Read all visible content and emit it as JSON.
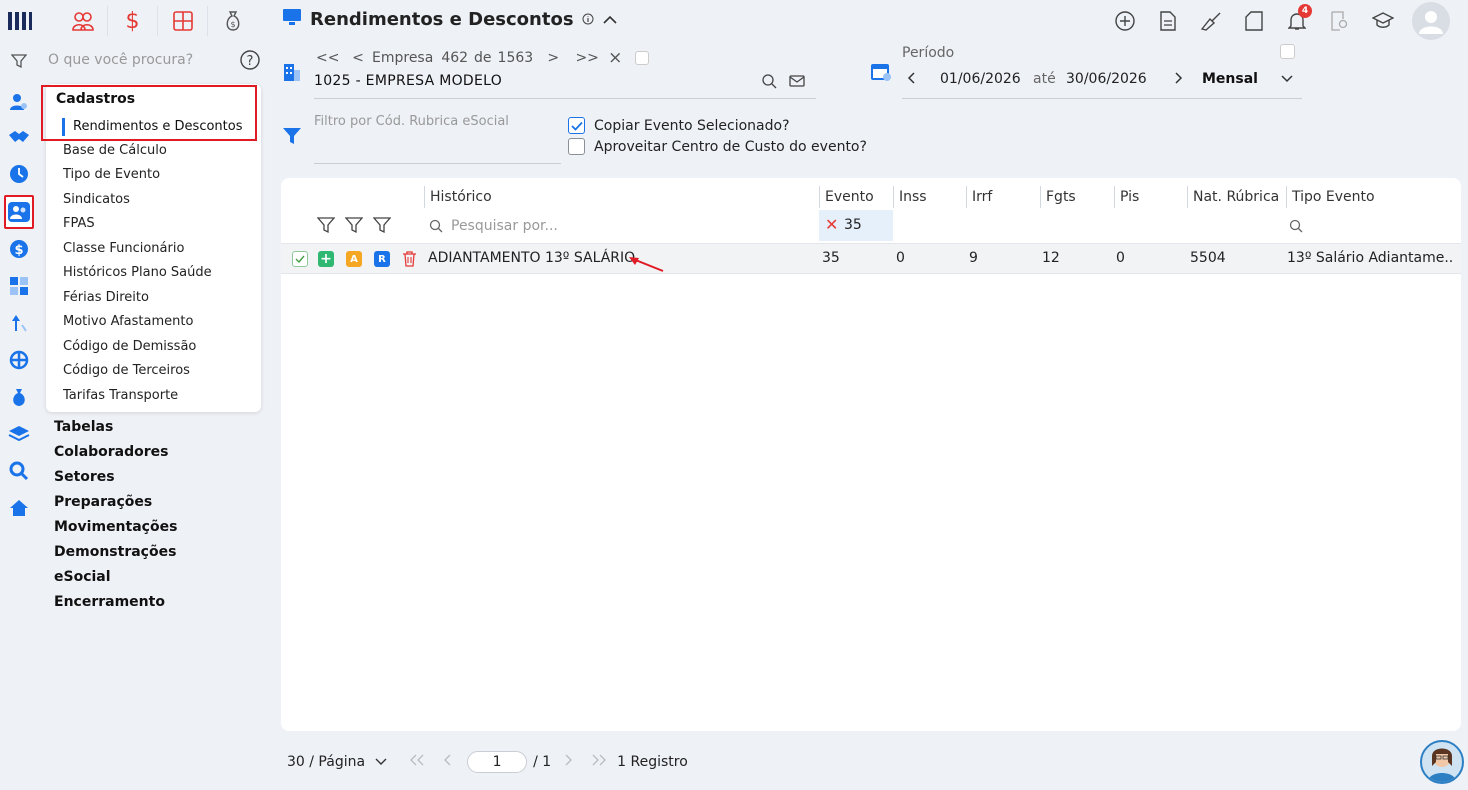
{
  "nav": {
    "search_placeholder": "O que você procura?",
    "menu": {
      "title": "Cadastros",
      "active_item": "Rendimentos e Descontos",
      "items": [
        "Base de Cálculo",
        "Tipo de Evento",
        "Sindicatos",
        "FPAS",
        "Classe Funcionário",
        "Históricos Plano Saúde",
        "Férias Direito",
        "Motivo Afastamento",
        "Código de Demissão",
        "Código de Terceiros",
        "Tarifas Transporte"
      ]
    },
    "sections": [
      "Tabelas",
      "Colaboradores",
      "Setores",
      "Preparações",
      "Movimentações",
      "Demonstrações",
      "eSocial",
      "Encerramento"
    ]
  },
  "header": {
    "title": "Rendimentos e Descontos",
    "notification_count": "4"
  },
  "empresa": {
    "nav_first": "<<",
    "nav_prev": "<",
    "label": "Empresa",
    "current": "462",
    "of": "de",
    "total": "1563",
    "nav_next": ">",
    "nav_last": ">>",
    "clear": "×",
    "name": "1025 - EMPRESA MODELO"
  },
  "periodo": {
    "label": "Período",
    "start": "01/06/2026",
    "sep": "até",
    "end": "30/06/2026",
    "type": "Mensal"
  },
  "filter": {
    "placeholder": "Filtro por Cód. Rubrica eSocial",
    "copy_label": "Copiar Evento Selecionado?",
    "copy_checked": true,
    "cc_label": "Aproveitar Centro de Custo do evento?",
    "cc_checked": false
  },
  "table": {
    "columns": [
      "Histórico",
      "Evento",
      "Inss",
      "Irrf",
      "Fgts",
      "Pis",
      "Nat. Rúbrica",
      "Tipo Evento"
    ],
    "search_placeholder": "Pesquisar por...",
    "evento_filter": "35",
    "actions": {
      "a": "A",
      "r": "R"
    },
    "rows": [
      {
        "historico": "ADIANTAMENTO 13º SALÁRIO",
        "evento": "35",
        "inss": "0",
        "irrf": "9",
        "fgts": "12",
        "pis": "0",
        "nat": "5504",
        "tipo": "13º Salário Adiantame..."
      }
    ]
  },
  "pager": {
    "per_page": "30 / Página",
    "page": "1",
    "total_pages": "/ 1",
    "records": "1 Registro"
  },
  "colors": {
    "accent": "#1a73e8",
    "red": "#e01b24"
  }
}
